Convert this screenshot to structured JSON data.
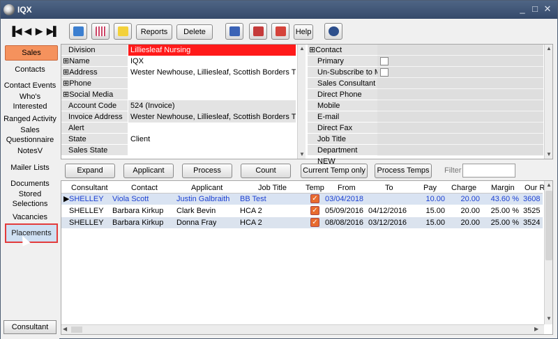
{
  "window": {
    "title": "IQX",
    "min": "_",
    "max": "□",
    "close": "✕"
  },
  "toolbar": {
    "reports": "Reports",
    "delete": "Delete",
    "help": "Help"
  },
  "sidebar": {
    "sales": "Sales",
    "contacts": "Contacts",
    "contact_events": "Contact Events",
    "whos_interested": "Who's Interested",
    "ranged_activity": "Ranged Activity",
    "sales_questionnaire": "Sales Questionnaire",
    "notesv": "NotesV",
    "mailer_lists": "Mailer Lists",
    "documents": "Documents",
    "stored_selections": "Stored Selections",
    "vacancies": "Vacancies",
    "placements": "Placements",
    "consultant": "Consultant"
  },
  "details": {
    "labels": {
      "division": "Division",
      "name": "Name",
      "address": "Address",
      "phone": "Phone",
      "social_media": "Social Media",
      "account_code": "Account Code",
      "invoice_address": "Invoice Address",
      "alert": "Alert",
      "state": "State",
      "sales_state": "Sales State"
    },
    "values": {
      "division": "Lilliesleaf Nursing",
      "name": "IQX",
      "address": "Wester Newhouse, Lilliesleaf, Scottish Borders TD",
      "account_code": "524 (Invoice)",
      "invoice_address": "Wester Newhouse, Lilliesleaf, Scottish Borders TD",
      "state": "Client"
    },
    "contact": {
      "contact": "Contact",
      "primary": "Primary",
      "unsubscribe": "Un-Subscribe to M",
      "sales_consultant": "Sales Consultant",
      "direct_phone": "Direct Phone",
      "mobile": "Mobile",
      "email": "E-mail",
      "direct_fax": "Direct Fax",
      "job_title": "Job Title",
      "department": "Department NEW"
    }
  },
  "buttons": {
    "expand": "Expand",
    "applicant": "Applicant",
    "process": "Process",
    "count": "Count",
    "current_temp": "Current Temp only",
    "process_temps": "Process Temps",
    "filter": "Filter"
  },
  "grid": {
    "headers": {
      "consultant": "Consultant",
      "contact": "Contact",
      "applicant": "Applicant",
      "job_title": "Job Title",
      "temp": "Temp",
      "from": "From",
      "to": "To",
      "pay": "Pay",
      "charge": "Charge",
      "margin": "Margin",
      "our_ref": "Our R"
    },
    "rows": [
      {
        "consultant": "SHELLEY",
        "contact": "Viola Scott",
        "applicant": "Justin Galbraith",
        "job_title": "BB Test",
        "from": "03/04/2018",
        "to": "",
        "pay": "10.00",
        "charge": "20.00",
        "margin": "43.60 %",
        "ref": "3608"
      },
      {
        "consultant": "SHELLEY",
        "contact": "Barbara Kirkup",
        "applicant": "Clark Bevin",
        "job_title": "HCA 2",
        "from": "05/09/2016",
        "to": "04/12/2016",
        "pay": "15.00",
        "charge": "20.00",
        "margin": "25.00 %",
        "ref": "3525"
      },
      {
        "consultant": "SHELLEY",
        "contact": "Barbara Kirkup",
        "applicant": "Donna Fray",
        "job_title": "HCA 2",
        "from": "08/08/2016",
        "to": "03/12/2016",
        "pay": "15.00",
        "charge": "20.00",
        "margin": "25.00 %",
        "ref": "3524"
      }
    ]
  },
  "colors": {
    "accent": "#f5925d",
    "selected_row_text": "#1a3fd1",
    "division_bg": "#ff1a1a"
  }
}
